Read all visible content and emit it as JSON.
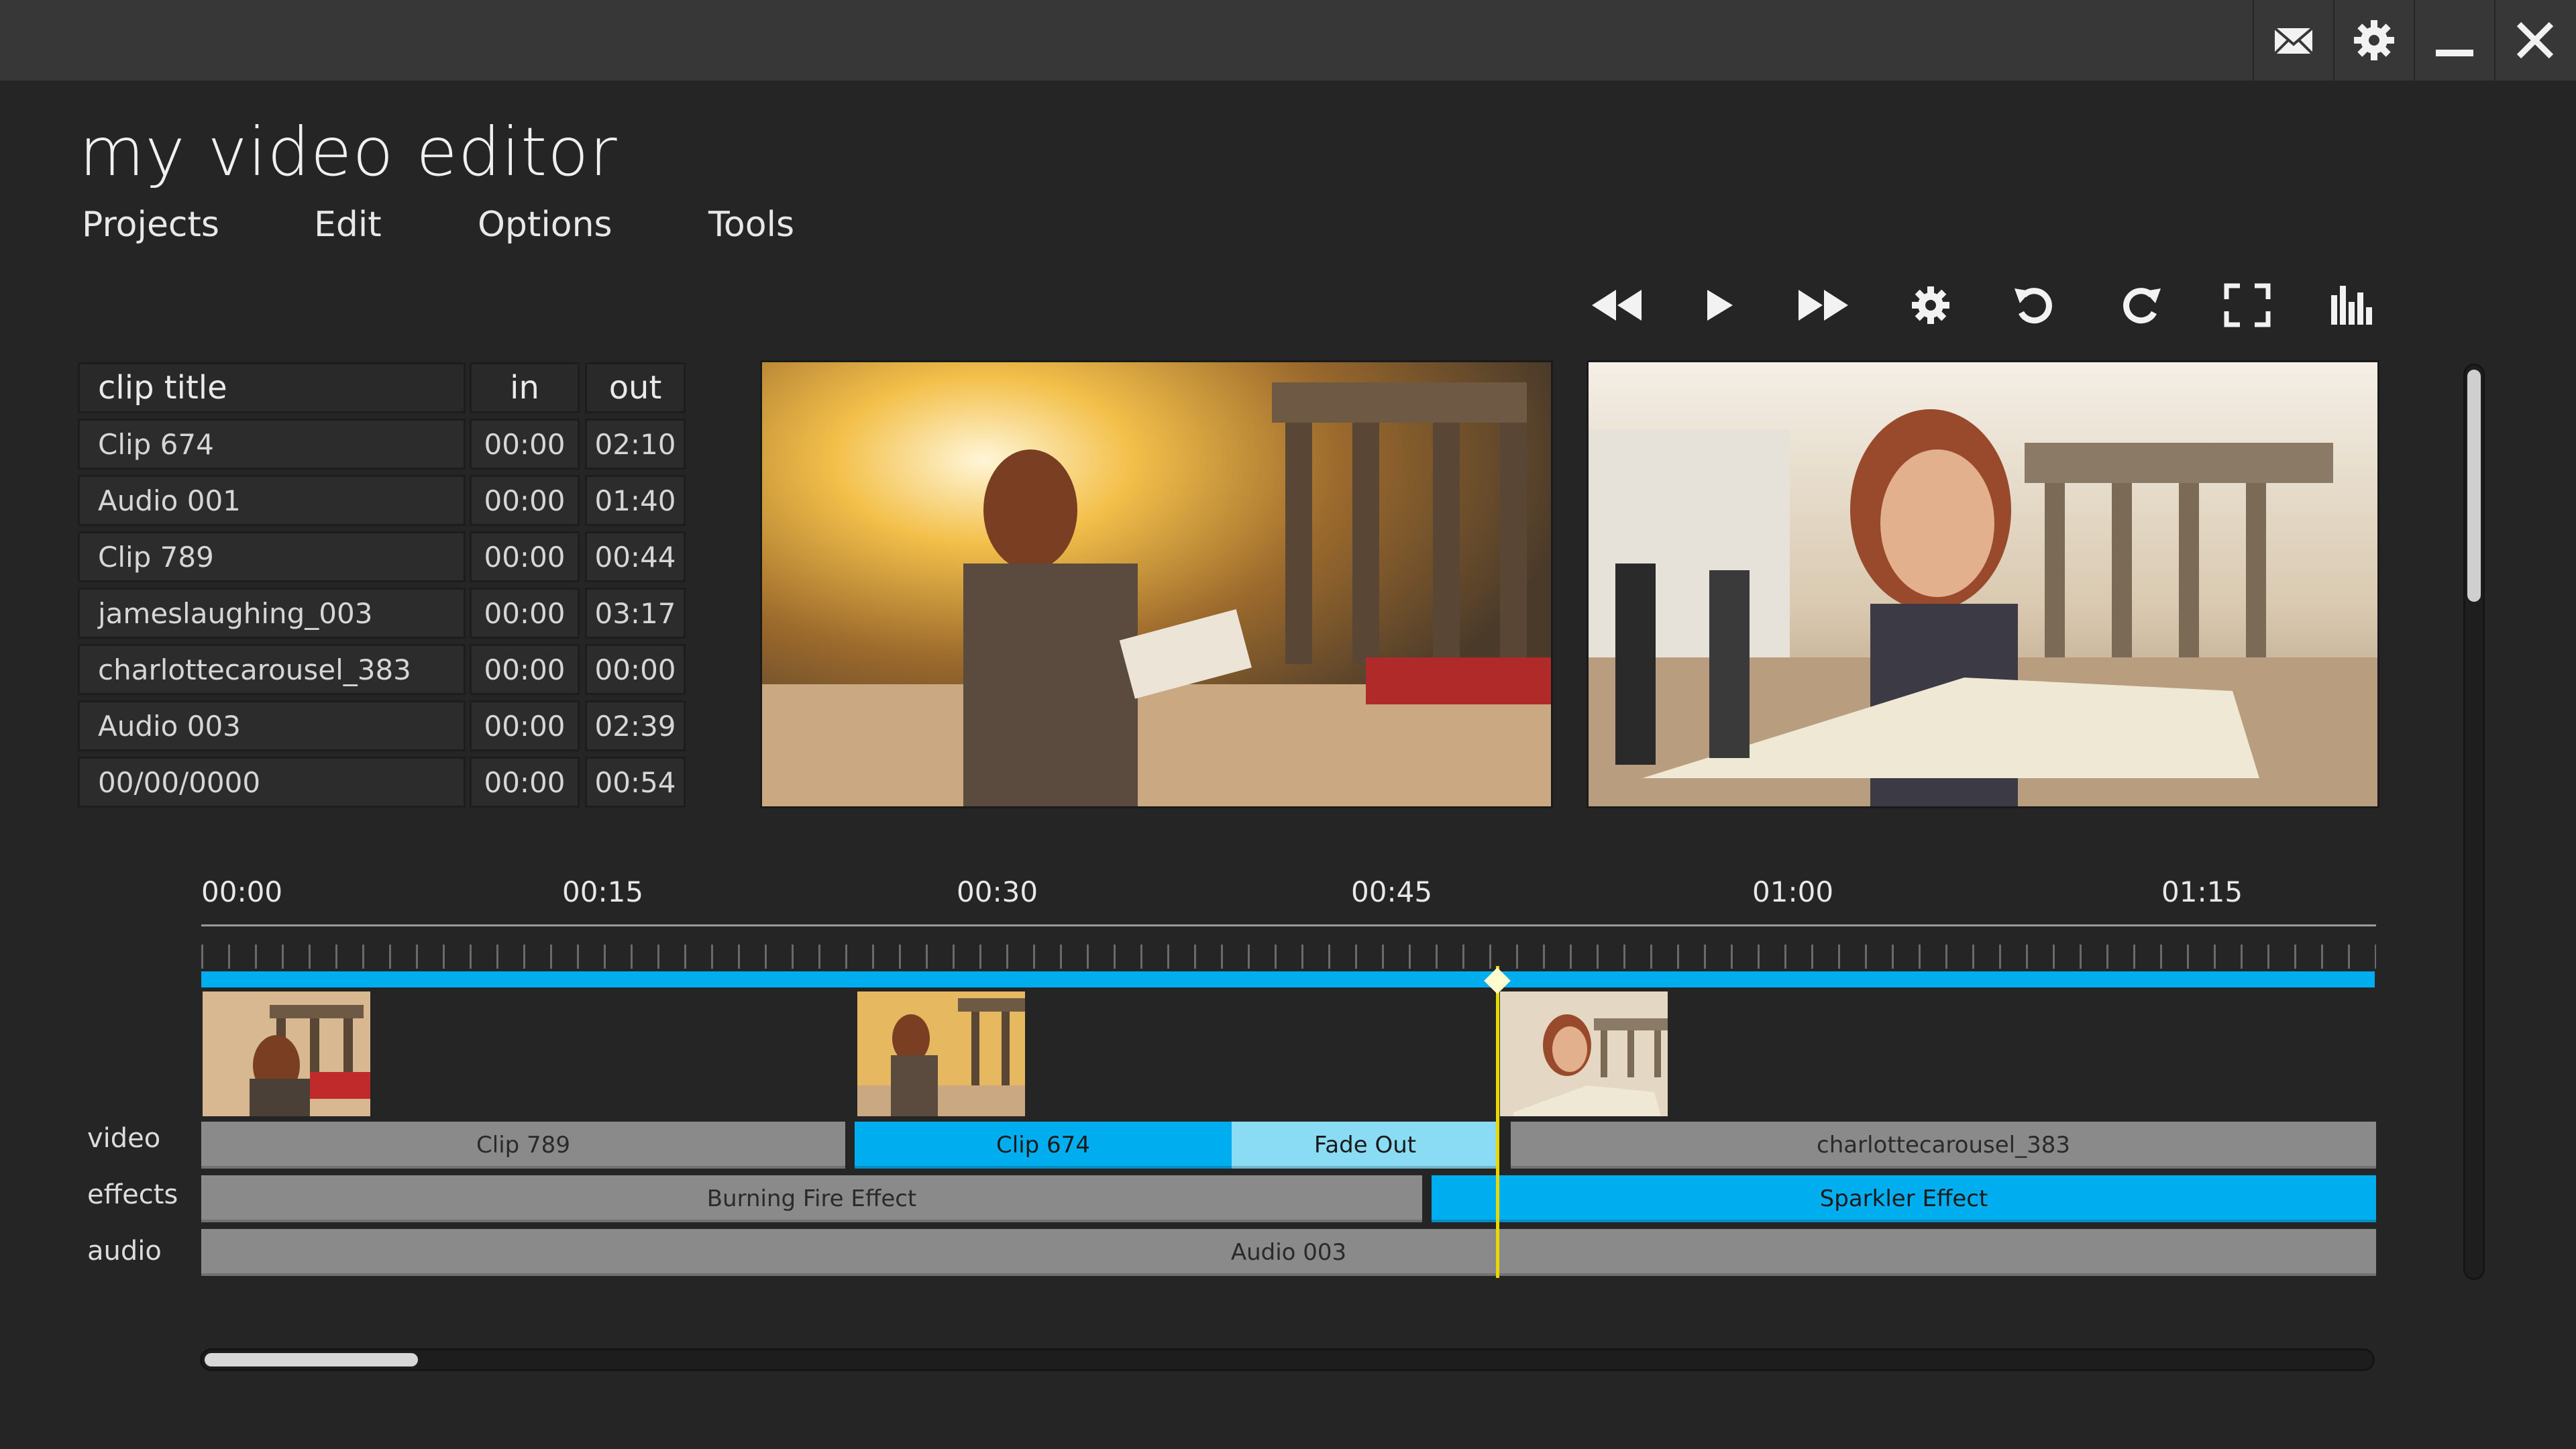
{
  "app": {
    "title": "my video editor"
  },
  "menu": [
    {
      "label": "Projects"
    },
    {
      "label": "Edit"
    },
    {
      "label": "Options"
    },
    {
      "label": "Tools"
    }
  ],
  "window_controls": [
    "mail-icon",
    "gear-icon",
    "minimize-icon",
    "close-icon"
  ],
  "transport": [
    "rewind-icon",
    "play-icon",
    "fast-forward-icon",
    "settings-icon",
    "undo-icon",
    "redo-icon",
    "fullscreen-icon",
    "levels-icon"
  ],
  "clip_table": {
    "headers": {
      "title": "clip title",
      "in": "in",
      "out": "out"
    },
    "rows": [
      {
        "title": "Clip 674",
        "in": "00:00",
        "out": "02:10"
      },
      {
        "title": "Audio 001",
        "in": "00:00",
        "out": "01:40"
      },
      {
        "title": "Clip 789",
        "in": "00:00",
        "out": "00:44"
      },
      {
        "title": "jameslaughing_003",
        "in": "00:00",
        "out": "03:17"
      },
      {
        "title": "charlottecarousel_383",
        "in": "00:00",
        "out": "00:00"
      },
      {
        "title": "Audio 003",
        "in": "00:00",
        "out": "02:39"
      },
      {
        "title": "00/00/0000",
        "in": "00:00",
        "out": "00:54"
      }
    ]
  },
  "timeline": {
    "ruler": [
      "00:00",
      "00:15",
      "00:30",
      "00:45",
      "01:00",
      "01:15"
    ],
    "tracks": {
      "video": {
        "label": "video",
        "segments": [
          {
            "label": "Clip 789"
          },
          {
            "label": "Clip 674"
          },
          {
            "label": "Fade Out"
          },
          {
            "label": "charlottecarousel_383"
          }
        ]
      },
      "effects": {
        "label": "effects",
        "segments": [
          {
            "label": "Burning Fire Effect"
          },
          {
            "label": "Sparkler Effect"
          }
        ]
      },
      "audio": {
        "label": "audio",
        "segments": [
          {
            "label": "Audio 003"
          }
        ]
      }
    }
  },
  "colors": {
    "accent": "#00aeef",
    "accent_light": "#8adcf5",
    "segment_gray": "#8a8a8a",
    "playhead": "#e8d800",
    "background": "#252525"
  }
}
